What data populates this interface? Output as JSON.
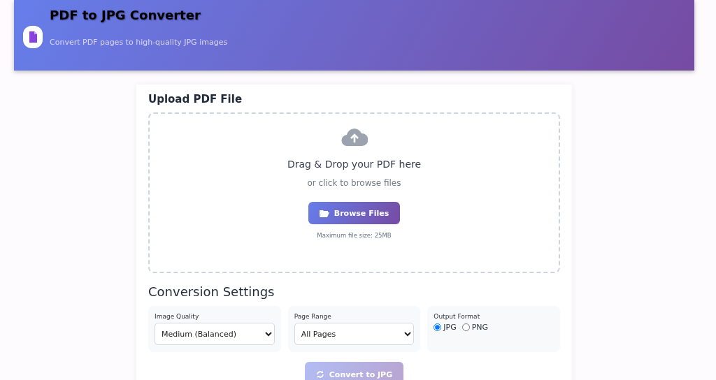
{
  "header": {
    "title": "PDF to JPG Converter",
    "subtitle": "Convert PDF pages to high-quality JPG images"
  },
  "upload": {
    "heading": "Upload PDF File",
    "prompt": "Drag & Drop your PDF here",
    "hint": "or click to browse files",
    "button": "Browse Files",
    "limit": "Maximum file size: 25MB"
  },
  "settings": {
    "heading": "Conversion Settings",
    "fields": [
      {
        "kind": "select",
        "label": "Image Quality",
        "value": "Medium (Balanced)"
      },
      {
        "kind": "select",
        "label": "Page Range",
        "value": "All Pages"
      },
      {
        "kind": "radio",
        "label": "Output Format",
        "options": [
          {
            "label": "JPG",
            "selected": true
          },
          {
            "label": "PNG",
            "selected": false
          }
        ]
      }
    ]
  },
  "convert": {
    "label": "Convert to JPG",
    "disabled": true
  }
}
